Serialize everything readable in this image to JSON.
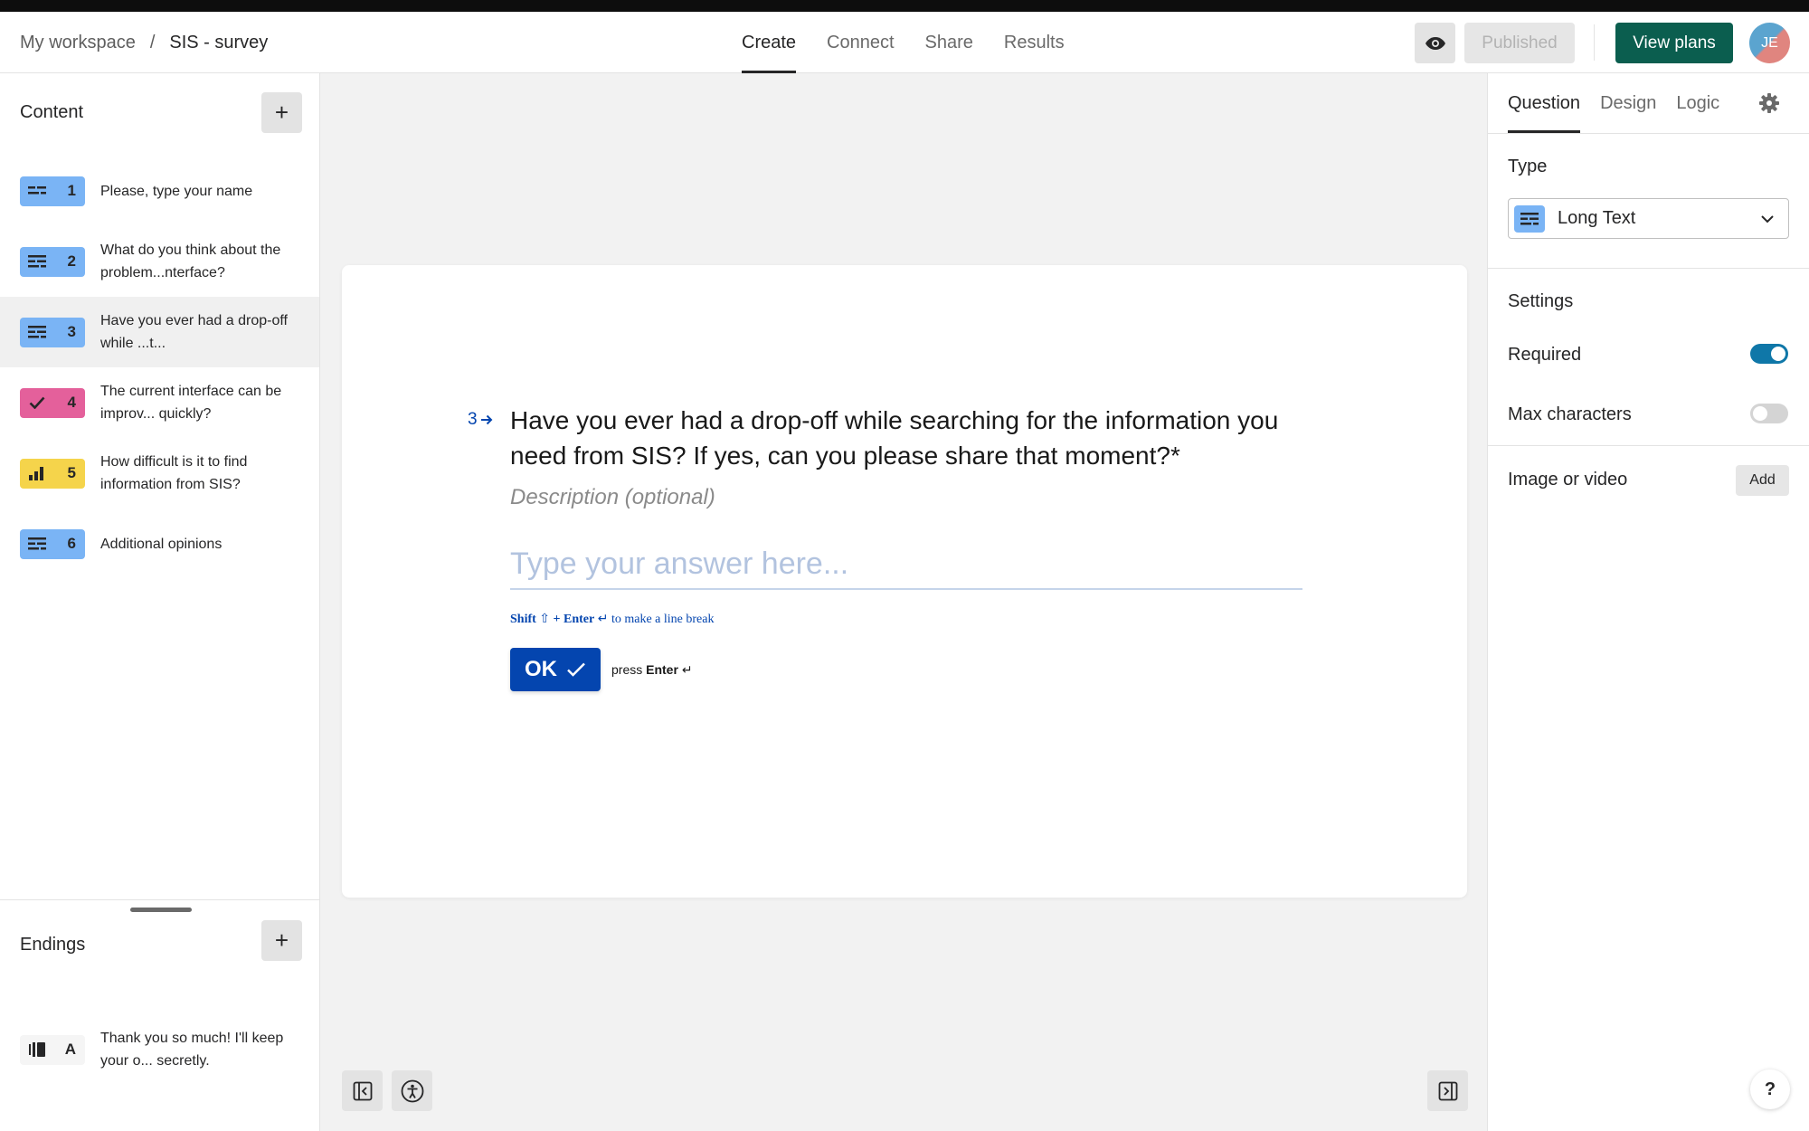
{
  "breadcrumb": {
    "workspace": "My workspace",
    "separator": "/",
    "form": "SIS - survey"
  },
  "nav_tabs": [
    {
      "label": "Create",
      "active": true
    },
    {
      "label": "Connect",
      "active": false
    },
    {
      "label": "Share",
      "active": false
    },
    {
      "label": "Results",
      "active": false
    }
  ],
  "header": {
    "preview_icon": "eye-icon",
    "published_label": "Published",
    "plans_label": "View plans",
    "avatar_initials": "JE"
  },
  "sidebar": {
    "content_title": "Content",
    "add_symbol": "+",
    "questions": [
      {
        "number": "1",
        "icon": "short-text-icon",
        "color": "#7ab4f5",
        "text": "Please, type your name"
      },
      {
        "number": "2",
        "icon": "long-text-icon",
        "color": "#7ab4f5",
        "text": "What do you think about the problem...nterface?"
      },
      {
        "number": "3",
        "icon": "long-text-icon",
        "color": "#7ab4f5",
        "text": "Have you ever had a drop-off while ...t..."
      },
      {
        "number": "4",
        "icon": "checkmark-icon",
        "color": "#e4609b",
        "text": "The current interface can be improv... quickly?"
      },
      {
        "number": "5",
        "icon": "bar-chart-icon",
        "color": "#f5d44b",
        "text": "How difficult is it to find information from SIS?"
      },
      {
        "number": "6",
        "icon": "long-text-icon",
        "color": "#7ab4f5",
        "text": "Additional opinions"
      }
    ],
    "endings_title": "Endings",
    "ending": {
      "letter": "A",
      "icon": "ending-icon",
      "text": "Thank you so much! I'll keep your o... secretly."
    }
  },
  "question_card": {
    "number": "3",
    "title": "Have you ever had a drop-off while searching for the information you need from SIS? If yes, can you please share that moment?*",
    "description_placeholder": "Description (optional)",
    "answer_placeholder": "Type your answer here...",
    "hint_shift": "Shift",
    "hint_shift_symbol": "⇧",
    "hint_plus": "+",
    "hint_enter": "Enter",
    "hint_enter_symbol": "↵",
    "hint_rest": "to make a line break",
    "ok_label": "OK",
    "press_label": "press",
    "press_enter": "Enter",
    "press_symbol": "↵"
  },
  "right_panel": {
    "tabs": [
      {
        "label": "Question",
        "active": true
      },
      {
        "label": "Design",
        "active": false
      },
      {
        "label": "Logic",
        "active": false
      }
    ],
    "type_label": "Type",
    "type_value": "Long Text",
    "settings_label": "Settings",
    "required_label": "Required",
    "required_on": true,
    "max_chars_label": "Max characters",
    "max_chars_on": false,
    "media_label": "Image or video",
    "add_label": "Add",
    "help_label": "?"
  },
  "colors": {
    "brand_blue": "#0445af",
    "plans_green": "#0b5e4f",
    "toggle_on": "#0f77a8"
  }
}
